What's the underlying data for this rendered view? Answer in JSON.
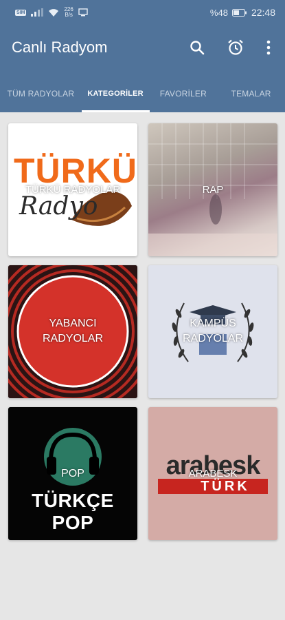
{
  "status_bar": {
    "net_speed": "226\nB/s",
    "battery": "%48",
    "time": "22:48"
  },
  "app": {
    "title": "Canlı Radyom"
  },
  "toolbar": {
    "icons": [
      "search-icon",
      "alarm-icon",
      "more-icon"
    ]
  },
  "tabs": [
    {
      "label": "TÜM RADYOLAR",
      "active": false
    },
    {
      "label": "KATEGORİLER",
      "active": true
    },
    {
      "label": "FAVORİLER",
      "active": false
    },
    {
      "label": "TEMALAR",
      "active": false
    }
  ],
  "categories": [
    {
      "label": "TÜRKÜ RADYOLAR",
      "art_title": "TÜRKÜ",
      "art_sub": "Radyo"
    },
    {
      "label": "RAP"
    },
    {
      "label": "YABANCI RADYOLAR"
    },
    {
      "label": "KAMPÜS RADYOLAR"
    },
    {
      "label": "POP",
      "art_title": "TÜRKÇE POP"
    },
    {
      "label": "ARABESK",
      "art_title": "arabesk",
      "art_sub": "TÜRK"
    }
  ]
}
